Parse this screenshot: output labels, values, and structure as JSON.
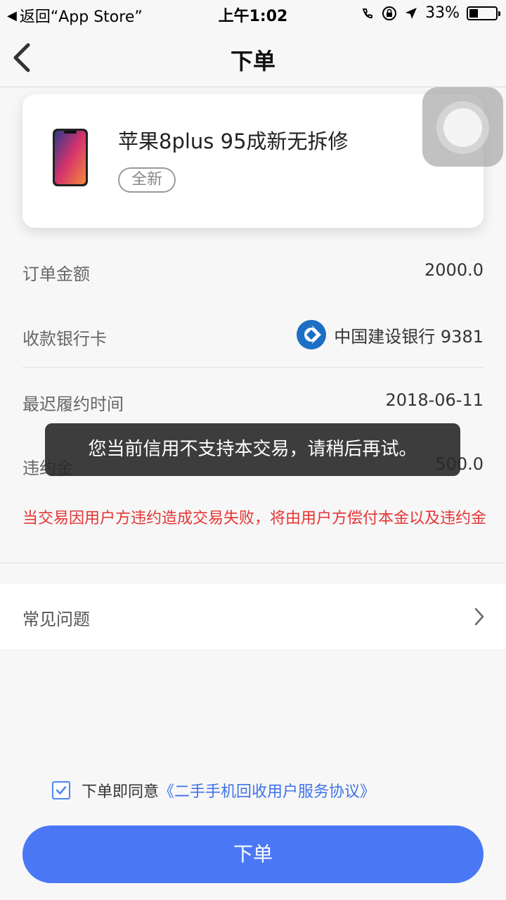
{
  "status_bar": {
    "back_app": "返回“App Store”",
    "time": "上午1:02",
    "battery": "33%",
    "battery_level": 0.33
  },
  "nav": {
    "title": "下单"
  },
  "product": {
    "title": "苹果8plus 95成新无拆修",
    "tag": "全新"
  },
  "order": {
    "amount_label": "订单金额",
    "amount_value": "2000.0",
    "bank_label": "收款银行卡",
    "bank_value": "中国建设银行 9381",
    "deadline_label": "最迟履约时间",
    "deadline_value": "2018-06-11",
    "penalty_label": "违约金",
    "penalty_value": "500.0",
    "warning": "当交易因用户方违约造成交易失败，将由用户方偿付本金以及违约金"
  },
  "faq": {
    "label": "常见问题"
  },
  "toast": "您当前信用不支持本交易，请稍后再试。",
  "agreement": {
    "prefix": "下单即同意",
    "link": "《二手手机回收用户服务协议》",
    "checked": true
  },
  "submit": {
    "label": "下单"
  },
  "colors": {
    "accent": "#4a78f5",
    "warning": "#e63434",
    "bank_logo": "#1d6fc4"
  }
}
